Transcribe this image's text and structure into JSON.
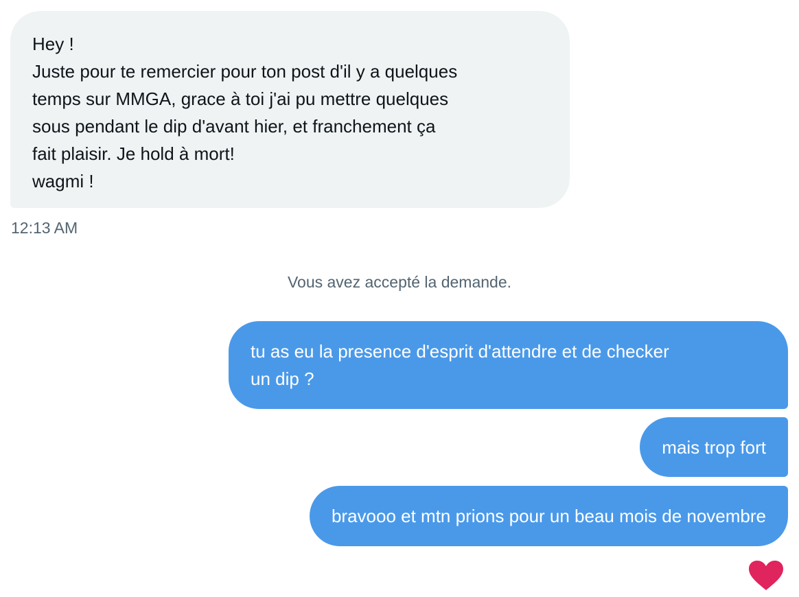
{
  "conversation": {
    "incoming_message": {
      "lines": [
        "Hey !",
        "Juste pour te remercier pour ton post d'il y a quelques",
        "temps sur MMGA, grace à toi j'ai pu mettre quelques",
        "sous pendant le dip d'avant hier, et franchement ça",
        "fait plaisir. Je hold à mort!",
        "wagmi !"
      ],
      "timestamp": "12:13 AM"
    },
    "system_message": "Vous avez accepté la demande.",
    "outgoing_messages": [
      {
        "lines": [
          "tu as eu la presence d'esprit d'attendre et de checker",
          "un dip ?"
        ]
      },
      {
        "lines": [
          "mais trop fort"
        ]
      },
      {
        "lines": [
          "bravooo et mtn prions pour un beau mois de novembre"
        ]
      }
    ],
    "reaction": {
      "icon": "heart-icon",
      "color": "#e0245e"
    }
  },
  "colors": {
    "incoming_bubble": "#eff3f4",
    "outgoing_bubble": "#4a99e9",
    "secondary_text": "#536471"
  }
}
